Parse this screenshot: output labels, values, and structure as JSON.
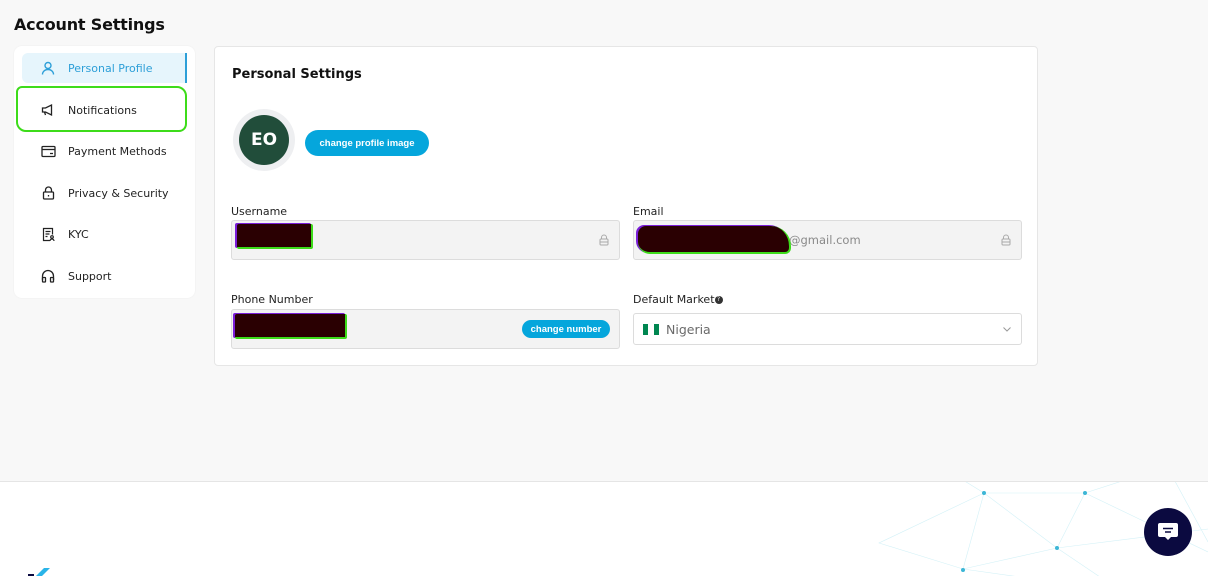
{
  "page": {
    "title": "Account Settings"
  },
  "sidebar": {
    "items": [
      {
        "label": "Personal Profile",
        "icon": "user-icon",
        "active": true
      },
      {
        "label": "Notifications",
        "icon": "megaphone-icon",
        "active": false
      },
      {
        "label": "Payment Methods",
        "icon": "card-icon",
        "active": false
      },
      {
        "label": "Privacy & Security",
        "icon": "lock-icon",
        "active": false
      },
      {
        "label": "KYC",
        "icon": "document-user-icon",
        "active": false
      },
      {
        "label": "Support",
        "icon": "headphones-icon",
        "active": false
      }
    ]
  },
  "settings": {
    "title": "Personal Settings",
    "avatar_initials": "EO",
    "change_image_label": "change profile image",
    "username": {
      "label": "Username",
      "value": "[redacted]",
      "locked": true
    },
    "email": {
      "label": "Email",
      "value_suffix": "@gmail.com",
      "locked": true
    },
    "phone": {
      "label": "Phone Number",
      "value": "[redacted]",
      "change_label": "change number"
    },
    "market": {
      "label": "Default Market",
      "value": "Nigeria",
      "flag_colors": [
        "#008751",
        "#ffffff",
        "#008751"
      ]
    }
  },
  "colors": {
    "accent": "#05a6dc",
    "avatar": "#214d3a",
    "chat": "#0b0a40"
  },
  "chat": {
    "icon": "chat-icon"
  }
}
